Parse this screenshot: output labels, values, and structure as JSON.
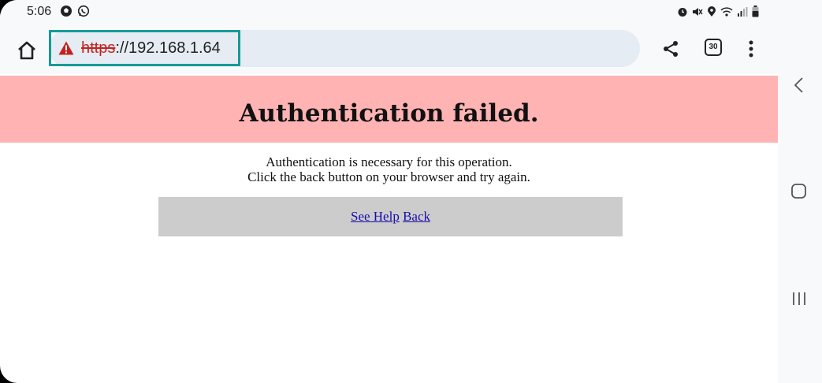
{
  "status": {
    "time": "5:06"
  },
  "browser": {
    "url_scheme": "https",
    "url_rest": "://192.168.1.64",
    "tab_count": "30"
  },
  "page": {
    "title": "Authentication failed.",
    "message_line1": "Authentication is necessary for this operation.",
    "message_line2": "Click the back button on your browser and try again.",
    "link_help": "See Help",
    "link_back": "Back"
  },
  "colors": {
    "header_bg": "#ffb3b3",
    "link": "#1a0dab",
    "url_highlight": "#159c97",
    "warning": "#c5221f"
  }
}
